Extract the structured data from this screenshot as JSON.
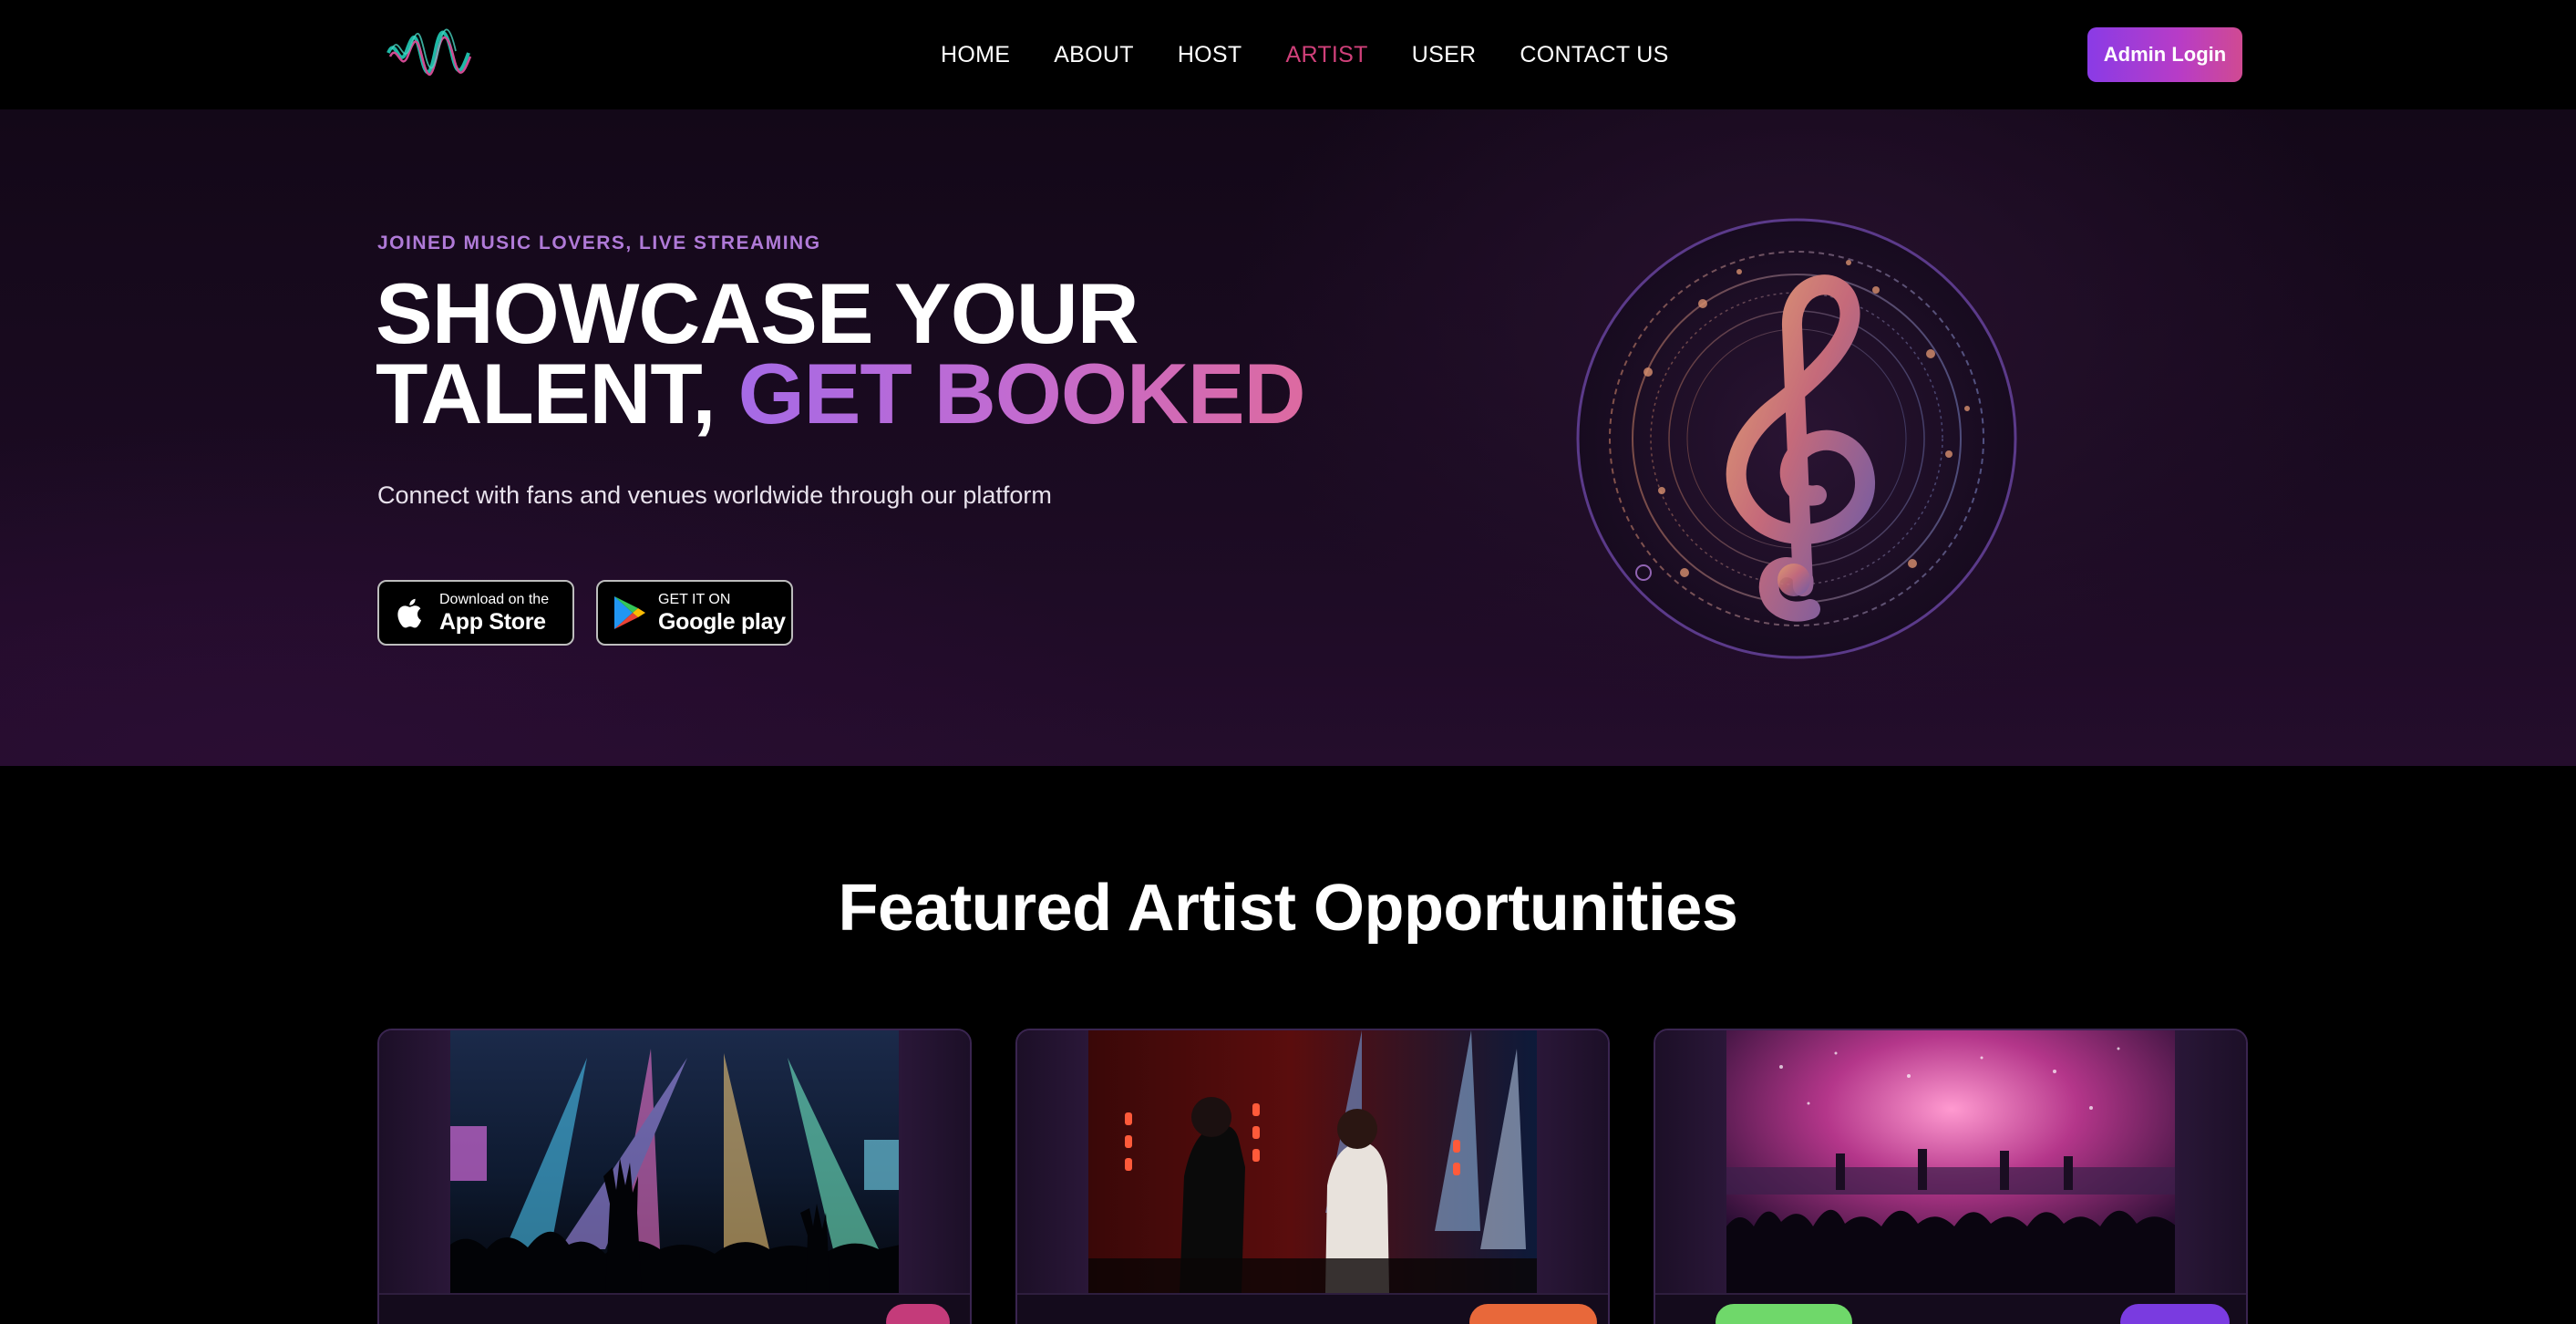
{
  "header": {
    "nav": [
      "HOME",
      "ABOUT",
      "HOST",
      "ARTIST",
      "USER",
      "CONTACT US"
    ],
    "active_nav": "ARTIST",
    "admin_button": "Admin Login"
  },
  "hero": {
    "eyebrow": "JOINED MUSIC LOVERS, LIVE STREAMING",
    "headline_line1": "SHOWCASE YOUR",
    "headline_line2_plain": "TALENT,",
    "headline_line2_accent": "GET BOOKED",
    "subtitle": "Connect with fans and venues worldwide through our platform",
    "app_store": {
      "small": "Download on the",
      "big": "App Store",
      "icon": "apple-icon"
    },
    "google_play": {
      "small": "GET IT ON",
      "big": "Google play",
      "icon": "google-play-icon"
    }
  },
  "featured": {
    "title": "Featured Artist Opportunities",
    "cards": [
      {
        "image": "concert-crowd-lights-image"
      },
      {
        "image": "duo-performers-stage-image"
      },
      {
        "image": "band-pink-stage-image"
      }
    ]
  },
  "colors": {
    "accent_purple": "#8a3be6",
    "accent_pink": "#d0407a",
    "eyebrow": "#b07ad8"
  }
}
